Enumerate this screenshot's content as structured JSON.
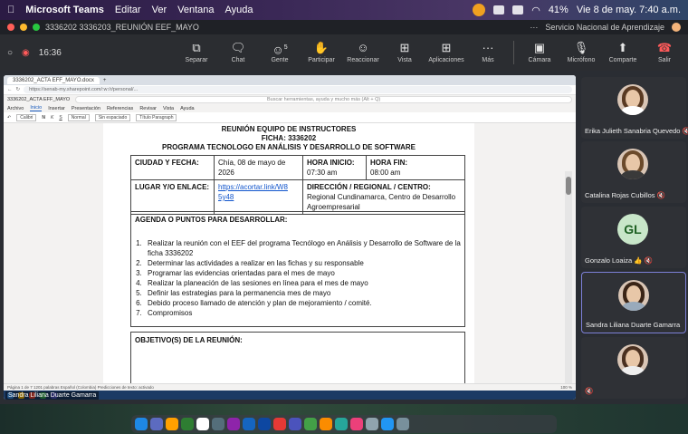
{
  "menubar": {
    "app": "Microsoft Teams",
    "items": [
      "Editar",
      "Ver",
      "Ventana",
      "Ayuda"
    ],
    "battery": "41%",
    "datetime": "Vie 8 de may.  7:40 a.m."
  },
  "titlebar": {
    "meeting_title": "3336202 3336203_REUNIÓN EEF_MAYO",
    "org": "Servicio Nacional de Aprendizaje"
  },
  "toolbar": {
    "timer": "16:36",
    "buttons": [
      {
        "label": "Separar",
        "icon": "separate-icon"
      },
      {
        "label": "Chat",
        "icon": "chat-icon"
      },
      {
        "label": "Gente",
        "icon": "people-icon",
        "count": "5"
      },
      {
        "label": "Participar",
        "icon": "raise-hand-icon"
      },
      {
        "label": "Reaccionar",
        "icon": "react-icon"
      },
      {
        "label": "Vista",
        "icon": "view-icon"
      },
      {
        "label": "Aplicaciones",
        "icon": "apps-icon"
      },
      {
        "label": "Más",
        "icon": "more-icon"
      }
    ],
    "camera": "Cámara",
    "mic": "Micrófono",
    "share": "Comparte",
    "leave": "Salir"
  },
  "shared": {
    "tab": "3336202_ACTA EFF_MAYO.docx",
    "url": "https://senab-my.sharepoint.com/:w:/r/personal/...",
    "doc_name": "3336202_ACTA EFF_MAYO",
    "search_placeholder": "Buscar herramientas, ayuda y mucho más (Alt + Q)",
    "menu": [
      "Archivo",
      "Inicio",
      "Insertar",
      "Presentación",
      "Referencias",
      "Revisar",
      "Vista",
      "Ayuda"
    ],
    "style_box": "Normal",
    "style_box2": "Sin espaciado",
    "style_box3": "Título Paragraph",
    "presenter": "Sandra Liliana Duarte Gamarra",
    "status": "Página 1 de 7   1201 palabras   Español (Colombia)   Predicciones de texto: activado",
    "zoom": "100 %"
  },
  "document": {
    "header": [
      "REUNIÓN EQUIPO DE INSTRUCTORES",
      "FICHA: 3336202",
      "PROGRAMA TECNOLOGO EN ANÁLISIS Y DESARROLLO DE SOFTWARE"
    ],
    "ciudad_label": "CIUDAD Y FECHA:",
    "ciudad_value": "Chía, 08 de mayo de 2026",
    "hora_inicio_label": "HORA INICIO:",
    "hora_inicio_value": "07:30 am",
    "hora_fin_label": "HORA FIN:",
    "hora_fin_value": "08:00 am",
    "lugar_label": "LUGAR Y/O ENLACE:",
    "lugar_link": "https://acortar.link/W8 5y48",
    "direccion_label": "DIRECCIÓN / REGIONAL / CENTRO:",
    "direccion_value": "Regional Cundinamarca, Centro de Desarrollo Agroempresarial",
    "agenda_title": "AGENDA O PUNTOS PARA DESARROLLAR:",
    "agenda": [
      "Realizar la reunión con el EEF del programa Tecnólogo en Análisis y Desarrollo de Software de la ficha 3336202",
      "Determinar las actividades a realizar en las fichas y su responsable",
      "Programar las evidencias orientadas para el mes de mayo",
      "Realizar la planeación de las sesiones en línea para el mes de mayo",
      "Definir las estrategias para la permanencia mes de mayo",
      "Debido proceso llamado de atención y plan de mejoramiento / comité.",
      "Compromisos"
    ],
    "objetivo_title": "OBJETIVO(S) DE LA REUNIÓN:"
  },
  "participants": [
    {
      "name": "Erika Julieth Sanabria Quevedo",
      "type": "photo",
      "mic": "off"
    },
    {
      "name": "Catalina Rojas Cubillos",
      "type": "photo",
      "mic": "off"
    },
    {
      "name": "Gonzalo Loaiza",
      "type": "initials",
      "initials": "GL",
      "mic": "off"
    },
    {
      "name": "Sandra Liliana Duarte Gamarra",
      "type": "photo",
      "mic": "off",
      "active": true
    },
    {
      "name": "",
      "type": "photo",
      "mic": "off"
    }
  ],
  "colors": {
    "teams_accent": "#7d80d8",
    "leave_red": "#ff5a5a",
    "link_blue": "#1155cc"
  }
}
